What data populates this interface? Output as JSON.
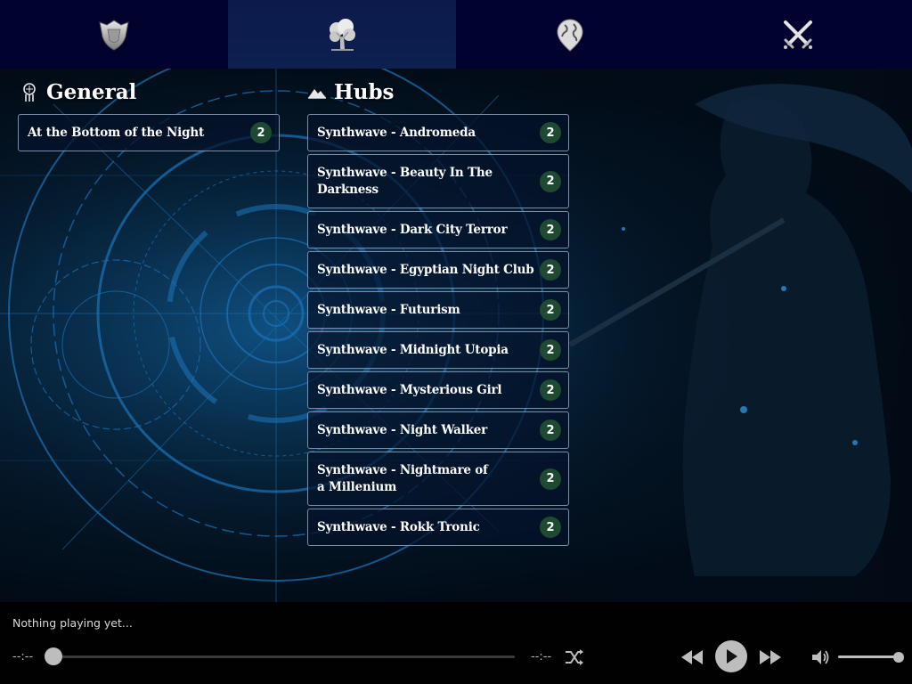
{
  "nav": {
    "tabs": [
      {
        "icon": "shield-icon",
        "active": false
      },
      {
        "icon": "tree-icon",
        "active": true
      },
      {
        "icon": "globe-pin-icon",
        "active": false
      },
      {
        "icon": "crossed-swords-icon",
        "active": false
      }
    ]
  },
  "general": {
    "title": "General",
    "icon": "dreamcatcher-icon",
    "items": [
      {
        "label": "At the Bottom of the Night",
        "count": "2"
      }
    ]
  },
  "hubs": {
    "title": "Hubs",
    "icon": "mountain-icon",
    "items": [
      {
        "label": "Synthwave - Andromeda",
        "count": "2"
      },
      {
        "label": "Synthwave - Beauty In The Darkness",
        "count": "2"
      },
      {
        "label": "Synthwave - Dark City Terror",
        "count": "2"
      },
      {
        "label": "Synthwave - Egyptian Night Club",
        "count": "2"
      },
      {
        "label": "Synthwave - Futurism",
        "count": "2"
      },
      {
        "label": "Synthwave - Midnight Utopia",
        "count": "2"
      },
      {
        "label": "Synthwave - Mysterious Girl",
        "count": "2"
      },
      {
        "label": "Synthwave - Night Walker",
        "count": "2"
      },
      {
        "label": "Synthwave - Nightmare of a Millenium",
        "count": "2"
      },
      {
        "label": "Synthwave - Rokk Tronic",
        "count": "2"
      }
    ]
  },
  "player": {
    "now_playing": "Nothing playing yet...",
    "time_elapsed": "--:--",
    "time_total": "--:--",
    "progress": 0,
    "volume": 1.0
  },
  "colors": {
    "nav_bg": "#02022e",
    "badge_bg": "#1e4a32",
    "item_border": "#7b8ea6"
  }
}
